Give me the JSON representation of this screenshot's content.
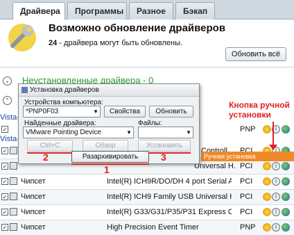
{
  "tabs": [
    {
      "label": "Драйвера"
    },
    {
      "label": "Программы"
    },
    {
      "label": "Разное"
    },
    {
      "label": "Бэкап"
    }
  ],
  "header": {
    "title": "Возможно обновление драйверов",
    "count": "24",
    "subtitle": " - драйвера могут быть обновлены.",
    "update_all": "Обновить всё"
  },
  "section": {
    "title": "Неустановленные драйвера - 0"
  },
  "vista_labels": [
    "Vista-",
    "Vista-"
  ],
  "rows": [
    {
      "cat": "",
      "name": "Controll",
      "bus": "PCI"
    },
    {
      "cat": "",
      "name": "Universal H...",
      "bus": "PCI"
    },
    {
      "cat": "Чипсет",
      "name": "Intel(R) ICH9R/DO/DH 4 port Serial A...",
      "bus": "PCI"
    },
    {
      "cat": "Чипсет",
      "name": "Intel(R) ICH9 Family USB Universal H...",
      "bus": "PCI"
    },
    {
      "cat": "Чипсет",
      "name": "Intel(R) G33/G31/P35/P31 Express C...",
      "bus": "PCI"
    },
    {
      "cat": "Чипсет",
      "name": "High Precision Event Timer",
      "bus": "PNP"
    }
  ],
  "pnp_row": {
    "bus": "PNP"
  },
  "dialog": {
    "title": "Установка драйверов",
    "devices_label": "Устройства компьютера:",
    "device_value": "*PNP0F03",
    "properties": "Свойства",
    "refresh": "Обновить",
    "found_label": "Найденные драйвера:",
    "files_label": "Файлы:",
    "found_value": "VMware Pointing Device",
    "files_value": "",
    "copy": "Ctrl+C",
    "browse": "Обзор",
    "install": "Установить",
    "extract": "Разархивировать"
  },
  "callouts": {
    "n1": "1",
    "n2": "2",
    "n3": "3",
    "annotation_line1": "Кнопка ручной",
    "annotation_line2": "установки",
    "tooltip": "Ручная установка"
  },
  "colors": {
    "accent_red": "#e02020",
    "green": "#2a9a2a",
    "tooltip": "#ee8a2a"
  }
}
